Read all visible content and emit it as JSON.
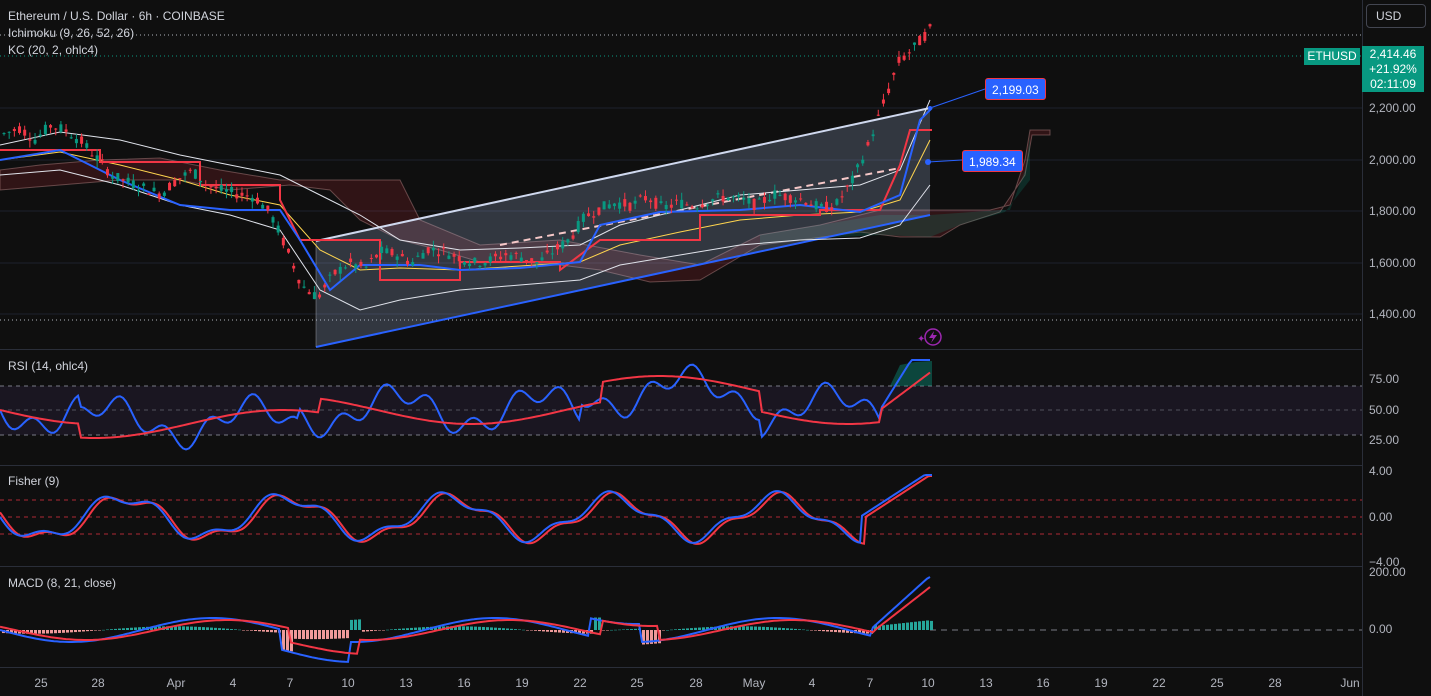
{
  "header": {
    "symbol_line": "Ethereum / U.S. Dollar · 6h · COINBASE",
    "ichimoku": "Ichimoku (9, 26, 52, 26)",
    "kc": "KC (20, 2, ohlc4)"
  },
  "currency_button": "USD",
  "last_price": {
    "ticker": "ETHUSD",
    "price": "2,414.46",
    "change": "+21.92%",
    "countdown": "02:11:09",
    "color": "#089981"
  },
  "callouts": {
    "upper": "2,199.03",
    "lower": "1,989.34"
  },
  "price_axis": [
    "2,200.00",
    "2,000.00",
    "1,800.00",
    "1,600.00",
    "1,400.00"
  ],
  "rsi": {
    "title": "RSI (14, ohlc4)",
    "axis": [
      "75.00",
      "50.00",
      "25.00"
    ]
  },
  "fisher": {
    "title": "Fisher (9)",
    "axis": [
      "4.00",
      "0.00",
      "−4.00"
    ]
  },
  "macd": {
    "title": "MACD (8, 21, close)",
    "axis": [
      "200.00",
      "0.00"
    ]
  },
  "time_axis": [
    "25",
    "28",
    "Apr",
    "4",
    "7",
    "10",
    "13",
    "16",
    "19",
    "22",
    "25",
    "28",
    "May",
    "4",
    "7",
    "10",
    "13",
    "16",
    "19",
    "22",
    "25",
    "28",
    "Jun"
  ],
  "colors": {
    "up": "#089981",
    "down": "#f23645",
    "rsi_line": "#2962ff",
    "signal_line": "#f23645",
    "channel": "#b2c7f0"
  },
  "chart_data": {
    "type": "candlestick",
    "price_range": [
      1300,
      2450
    ],
    "close_series": [
      2050,
      2070,
      2030,
      2080,
      2060,
      2020,
      1960,
      1900,
      1880,
      1860,
      1840,
      1890,
      1920,
      1870,
      1850,
      1840,
      1830,
      1770,
      1650,
      1520,
      1480,
      1560,
      1600,
      1580,
      1640,
      1630,
      1600,
      1650,
      1640,
      1620,
      1600,
      1610,
      1630,
      1620,
      1600,
      1640,
      1680,
      1760,
      1790,
      1810,
      1800,
      1830,
      1790,
      1810,
      1800,
      1820,
      1830,
      1820,
      1800,
      1840,
      1830,
      1820,
      1790,
      1800,
      1880,
      2000,
      2150,
      2300,
      2350,
      2414
    ],
    "rsi_range": [
      0,
      100
    ],
    "fisher_range": [
      -4,
      4
    ],
    "macd_range": [
      -100,
      200
    ]
  }
}
